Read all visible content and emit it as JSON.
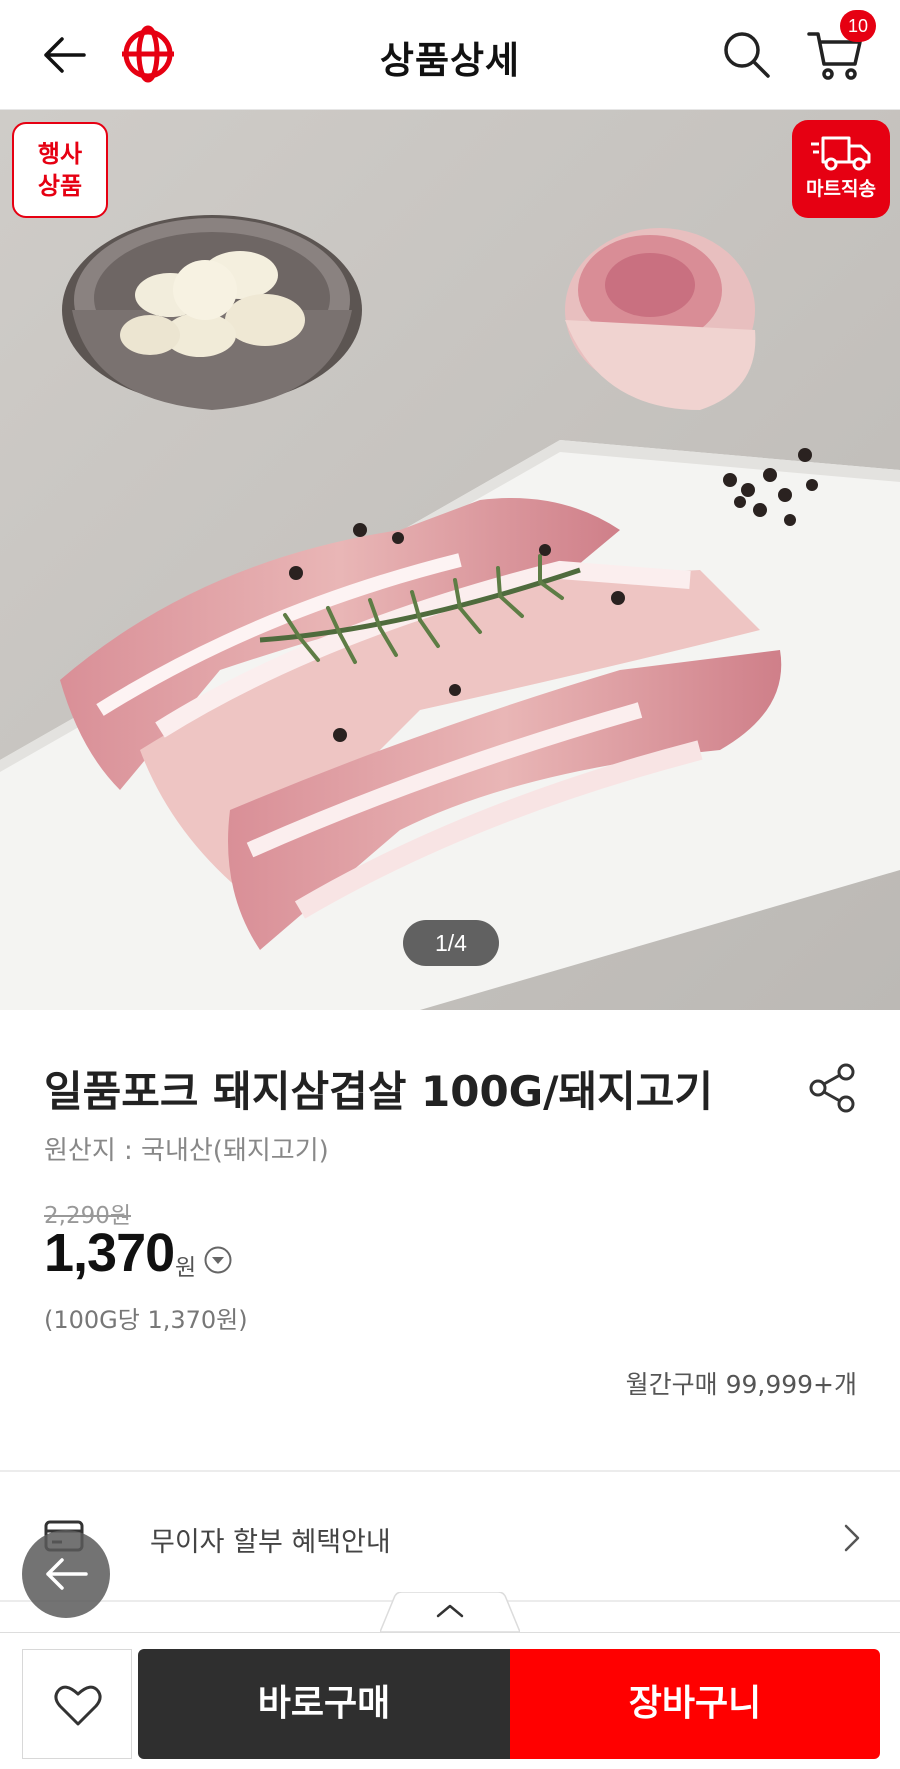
{
  "header": {
    "title": "상품상세",
    "cart_count": "10",
    "back_icon": "back-arrow-icon",
    "logo_icon": "brand-logo-icon",
    "search_icon": "search-icon",
    "cart_icon": "cart-icon"
  },
  "hero": {
    "event_badge": "행사\n상품",
    "event_badge_line1": "행사",
    "event_badge_line2": "상품",
    "mart_badge": "마트직송",
    "page_indicator": "1/4"
  },
  "product": {
    "name": "일품포크 돼지삼겹살 100G/돼지고기",
    "origin": "원산지 : 국내산(돼지고기)",
    "original_price": "2,290원",
    "price": "1,370",
    "price_unit": "원",
    "unit_price": "(100G당 1,370원)",
    "monthly_sales": "월간구매 99,999+개"
  },
  "benefit": {
    "label": "무이자 할부 혜택안내"
  },
  "bottom_bar": {
    "buy_now": "바로구매",
    "add_to_cart": "장바구니"
  },
  "colors": {
    "brand_red": "#e60012",
    "cart_button": "#ff0000",
    "buy_button": "#2f2f2f"
  }
}
